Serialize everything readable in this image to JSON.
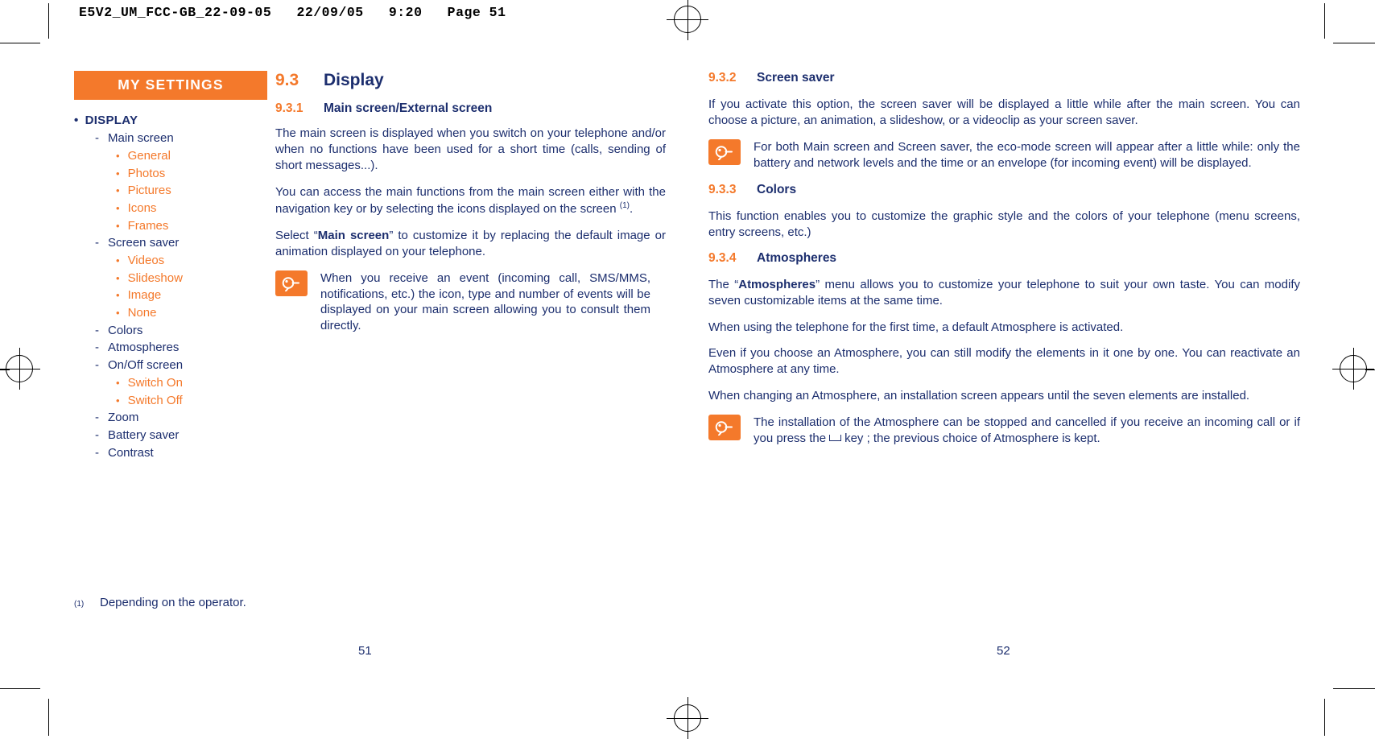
{
  "slug": "E5V2_UM_FCC-GB_22-09-05   22/09/05   9:20   Page 51",
  "sidebar": {
    "title": "MY SETTINGS",
    "items": [
      {
        "level": 1,
        "label": "DISPLAY"
      },
      {
        "level": 2,
        "label": "Main screen"
      },
      {
        "level": 3,
        "label": "General"
      },
      {
        "level": 3,
        "label": "Photos"
      },
      {
        "level": 3,
        "label": "Pictures"
      },
      {
        "level": 3,
        "label": "Icons"
      },
      {
        "level": 3,
        "label": "Frames"
      },
      {
        "level": 2,
        "label": "Screen saver"
      },
      {
        "level": 3,
        "label": "Videos"
      },
      {
        "level": 3,
        "label": "Slideshow"
      },
      {
        "level": 3,
        "label": "Image"
      },
      {
        "level": 3,
        "label": "None"
      },
      {
        "level": 2,
        "label": "Colors"
      },
      {
        "level": 2,
        "label": "Atmospheres"
      },
      {
        "level": 2,
        "label": "On/Off screen"
      },
      {
        "level": 3,
        "label": "Switch On"
      },
      {
        "level": 3,
        "label": "Switch Off"
      },
      {
        "level": 2,
        "label": "Zoom"
      },
      {
        "level": 2,
        "label": "Battery saver"
      },
      {
        "level": 2,
        "label": "Contrast"
      }
    ]
  },
  "left_column": {
    "section": {
      "number": "9.3",
      "title": "Display"
    },
    "sub1": {
      "number": "9.3.1",
      "title": "Main screen/External screen"
    },
    "p1": "The main screen is displayed when you switch on your telephone and/or when no functions have been used for a short time (calls, sending of short messages...).",
    "p2_a": "You can access the main functions from the main screen either with the navigation key or by selecting the icons displayed on the screen ",
    "p2_sup": "(1)",
    "p2_b": ".",
    "p3_a": "Select “",
    "p3_bold": "Main screen",
    "p3_b": "” to customize it by replacing the default image or animation displayed on your telephone.",
    "note1": "When you receive an event (incoming call, SMS/MMS, notifications, etc.) the icon, type and number of events will be displayed on your main screen allowing you to consult them directly."
  },
  "right_column": {
    "sub2": {
      "number": "9.3.2",
      "title": "Screen saver"
    },
    "p1": "If you activate this option, the screen saver will be displayed a little while after the main screen. You can choose a picture, an animation, a slideshow, or a videoclip as your screen saver.",
    "note1": "For both Main screen and Screen saver, the eco-mode screen will appear after a little while: only the battery and network levels and the time or an envelope (for incoming event) will be displayed.",
    "sub3": {
      "number": "9.3.3",
      "title": "Colors"
    },
    "p2": "This function enables you to customize the graphic style and the colors of your telephone (menu screens, entry screens, etc.)",
    "sub4": {
      "number": "9.3.4",
      "title": "Atmospheres"
    },
    "p3_a": "The “",
    "p3_bold": "Atmospheres",
    "p3_b": "” menu allows you to customize your telephone to suit your own taste. You can modify seven customizable items at the same time.",
    "p4": "When using the telephone for the first time, a default Atmosphere is activated.",
    "p5": "Even if you choose an Atmosphere, you can still modify the elements in it one by one. You can reactivate an Atmosphere at any time.",
    "p6": "When changing an Atmosphere, an installation screen appears until the seven elements are installed.",
    "note2_a": "The installation of the Atmosphere can be stopped and cancelled if you receive an incoming call or if you press the",
    "note2_b": "key ; the previous choice of Atmosphere is kept."
  },
  "footnote": {
    "mark": "(1)",
    "text": "Depending on the operator."
  },
  "folios": {
    "left": "51",
    "right": "52"
  },
  "colors": {
    "accent": "#f4792b",
    "text": "#1c2e6e"
  }
}
